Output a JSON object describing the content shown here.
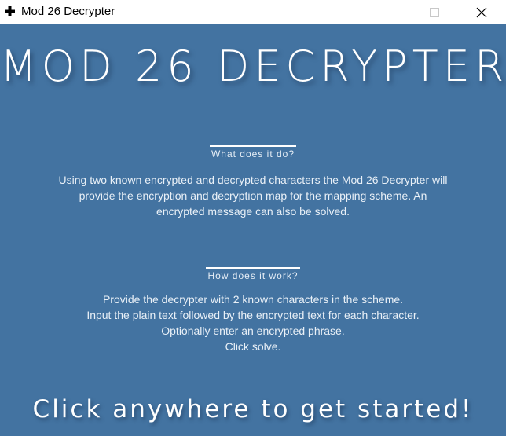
{
  "window": {
    "title": "Mod 26 Decrypter",
    "icon": "plus-icon",
    "buttons": {
      "minimize_icon": "minimize-icon",
      "maximize_icon": "maximize-icon",
      "close_icon": "close-icon"
    }
  },
  "colors": {
    "background": "#4373a1",
    "text": "#ffffff"
  },
  "main": {
    "title": "MOD 26 DECRYPTER",
    "what": {
      "heading": "What does it do?",
      "lines": [
        "Using two known encrypted and decrypted characters the Mod 26 Decrypter will",
        "provide the encryption and decryption map for the mapping scheme. An",
        "encrypted message can also be solved."
      ]
    },
    "how": {
      "heading": "How does it work?",
      "lines": [
        "Provide the decrypter with 2 known characters in the scheme.",
        "Input the plain text followed by the encrypted text for each character.",
        "Optionally enter an encrypted phrase.",
        "Click solve."
      ]
    },
    "cta": "Click anywhere to get started!"
  }
}
